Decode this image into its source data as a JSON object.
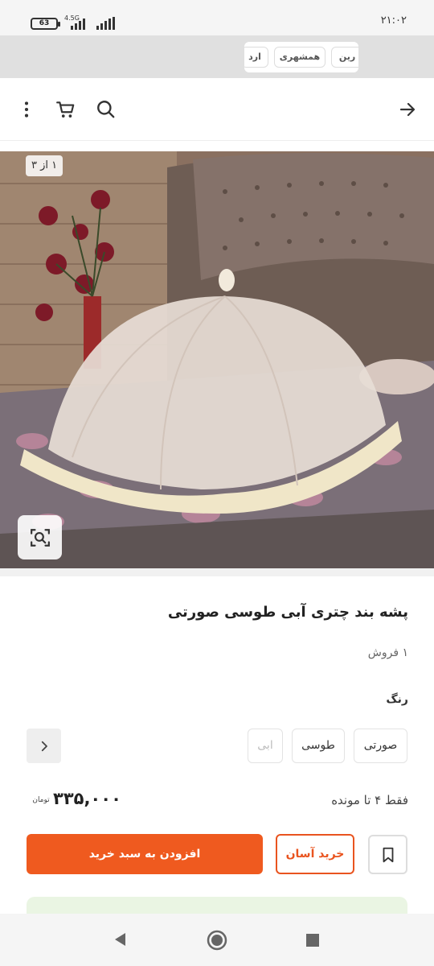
{
  "status_bar": {
    "time": "۲۱:۰۲",
    "battery": "63",
    "network": "4.5G"
  },
  "chips": [
    "رین",
    "همشهری",
    "ارد"
  ],
  "topbar_icons": [
    "arrow-right-icon",
    "search-icon",
    "cart-icon",
    "more-vert-icon"
  ],
  "product": {
    "image_counter": "۱ از ۳",
    "title": "پشه بند چتری آبی طوسی صورتی",
    "sales": "۱ فروش",
    "color_label": "رنگ",
    "colors": [
      {
        "label": "صورتی",
        "enabled": true
      },
      {
        "label": "طوسی",
        "enabled": true
      },
      {
        "label": "ابی",
        "enabled": false
      }
    ],
    "stock": "فقط ۴ تا مونده",
    "price": "۳۳۵,۰۰۰",
    "currency": "تومان"
  },
  "actions": {
    "easy_buy": "خرید آسان",
    "add_to_cart": "افزودن به سبد خرید"
  },
  "colors": {
    "accent": "#ef5a1f",
    "accent_border": "#e9541f",
    "banner": "#eaf5e3"
  }
}
